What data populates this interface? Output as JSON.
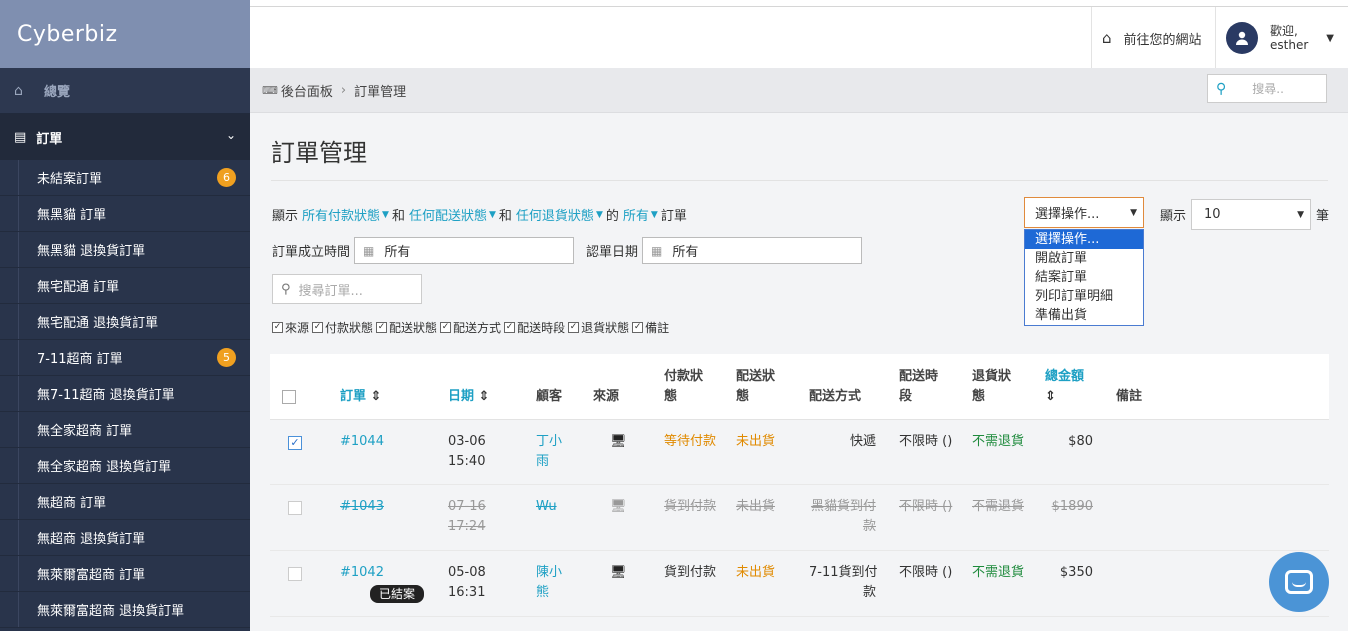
{
  "brand": {
    "logo": "Cyberbiz"
  },
  "sidebar": {
    "overview": "總覽",
    "group": "訂單",
    "items": [
      {
        "label": "未結案訂單",
        "badge": "6"
      },
      {
        "label": "無黑貓 訂單"
      },
      {
        "label": "無黑貓 退換貨訂單"
      },
      {
        "label": "無宅配通 訂單"
      },
      {
        "label": "無宅配通 退換貨訂單"
      },
      {
        "label": "7-11超商 訂單",
        "badge": "5"
      },
      {
        "label": "無7-11超商 退換貨訂單"
      },
      {
        "label": "無全家超商 訂單"
      },
      {
        "label": "無全家超商 退換貨訂單"
      },
      {
        "label": "無超商 訂單"
      },
      {
        "label": "無超商 退換貨訂單"
      },
      {
        "label": "無萊爾富超商 訂單"
      },
      {
        "label": "無萊爾富超商 退換貨訂單"
      }
    ]
  },
  "header": {
    "site_link": "前往您的網站",
    "welcome": "歡迎,",
    "username": "esther"
  },
  "breadcrumb": {
    "root": "後台面板",
    "current": "訂單管理"
  },
  "search_top": {
    "placeholder": "搜尋.."
  },
  "main": {
    "title": "訂單管理",
    "filter": {
      "show": "顯示",
      "payment": "所有付款狀態",
      "and1": "和",
      "shipping": "任何配送狀態",
      "and2": "和",
      "returns": "任何退貨狀態",
      "of": "的",
      "all": "所有",
      "orders": "訂單"
    },
    "created_label": "訂單成立時間",
    "created_value": "所有",
    "pickup_label": "認單日期",
    "pickup_value": "所有",
    "search_placeholder": "搜尋訂單...",
    "columns_toggle": [
      "來源",
      "付款狀態",
      "配送狀態",
      "配送方式",
      "配送時段",
      "退貨狀態",
      "備註"
    ],
    "action_select": "選擇操作...",
    "action_options": [
      "選擇操作...",
      "開啟訂單",
      "結案訂單",
      "列印訂單明細",
      "準備出貨"
    ],
    "show_label": "顯示",
    "show_value": "10",
    "unit_label": "筆"
  },
  "table": {
    "headers": {
      "order": "訂單",
      "date": "日期",
      "customer": "顧客",
      "source": "來源",
      "payment": "付款狀\n態",
      "shipping": "配送狀\n態",
      "method": "配送方式",
      "slot": "配送時\n段",
      "returns": "退貨狀\n態",
      "total": "總金額",
      "note": "備註"
    },
    "rows": [
      {
        "order": "#1044",
        "date": "03-06",
        "time": "15:40",
        "customer1": "丁小",
        "customer2": "雨",
        "payment": "等待付款",
        "shipping": "未出貨",
        "method1": "快遞",
        "method2": "",
        "slot": "不限時 ()",
        "returns": "不需退貨",
        "total": "$80"
      },
      {
        "order": "#1043",
        "date": "07-16",
        "time": "17:24",
        "customer1": "Wu",
        "customer2": "",
        "payment": "貨到付款",
        "shipping": "未出貨",
        "method1": "黑貓貨到付",
        "method2": "款",
        "slot": "不限時 ()",
        "returns": "不需退貨",
        "total": "$1890"
      },
      {
        "order": "#1042",
        "date": "05-08",
        "time": "16:31",
        "customer1": "陳小",
        "customer2": "熊",
        "payment": "貨到付款",
        "shipping": "未出貨",
        "method1": "7-11貨到付",
        "method2": "款",
        "slot": "不限時 ()",
        "returns": "不需退貨",
        "total": "$350",
        "badge": "已結案"
      }
    ]
  }
}
